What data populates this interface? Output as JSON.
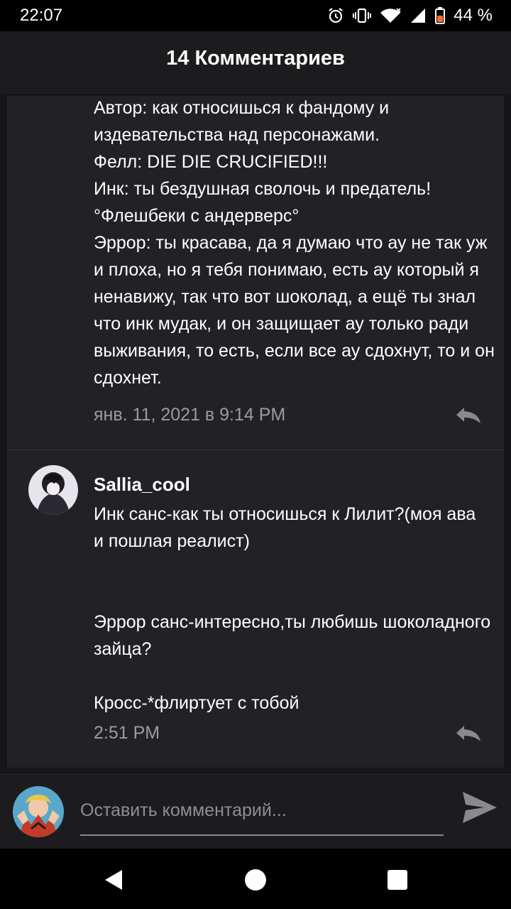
{
  "status_bar": {
    "time": "22:07",
    "battery": "44 %",
    "icons": [
      "alarm-icon",
      "vibrate-icon",
      "wifi-icon",
      "signal-icon",
      "battery-icon"
    ]
  },
  "header": {
    "title": "14 Комментариев"
  },
  "comments": [
    {
      "text": "Автор: как относишься к фандому и\nиздевательства над персонажами.\nФелл: DIE DIE CRUCIFIED!!!\nИнк: ты бездушная сволочь и предатель!\n°Флешбеки с андерверс°\nЭррор: ты красава, да я думаю что ау не так уж\nи плоха, но я тебя понимаю, есть ау который я\nненавижу, так что вот шоколад, а ещё ты знал\nчто инк мудак, и он защищает ау только ради\nвыживания, то есть, если все ау сдохнут, то и он\nсдохнет.",
      "time": "янв. 11, 2021 в 9:14 PM"
    },
    {
      "username": "Sallia_cool",
      "text": "Инк санс-как ты относишься к Лилит?(моя ава\nи пошлая реалист)\n\n\nЭррор санс-интересно,ты любишь шоколадного\nзайца?\n\nКросс-*флиртует с тобой",
      "time": "2:51 PM"
    }
  ],
  "composer": {
    "placeholder": "Оставить комментарий..."
  },
  "colors": {
    "background": "#161518",
    "card": "#222125",
    "muted_text": "#9c9ba0"
  }
}
